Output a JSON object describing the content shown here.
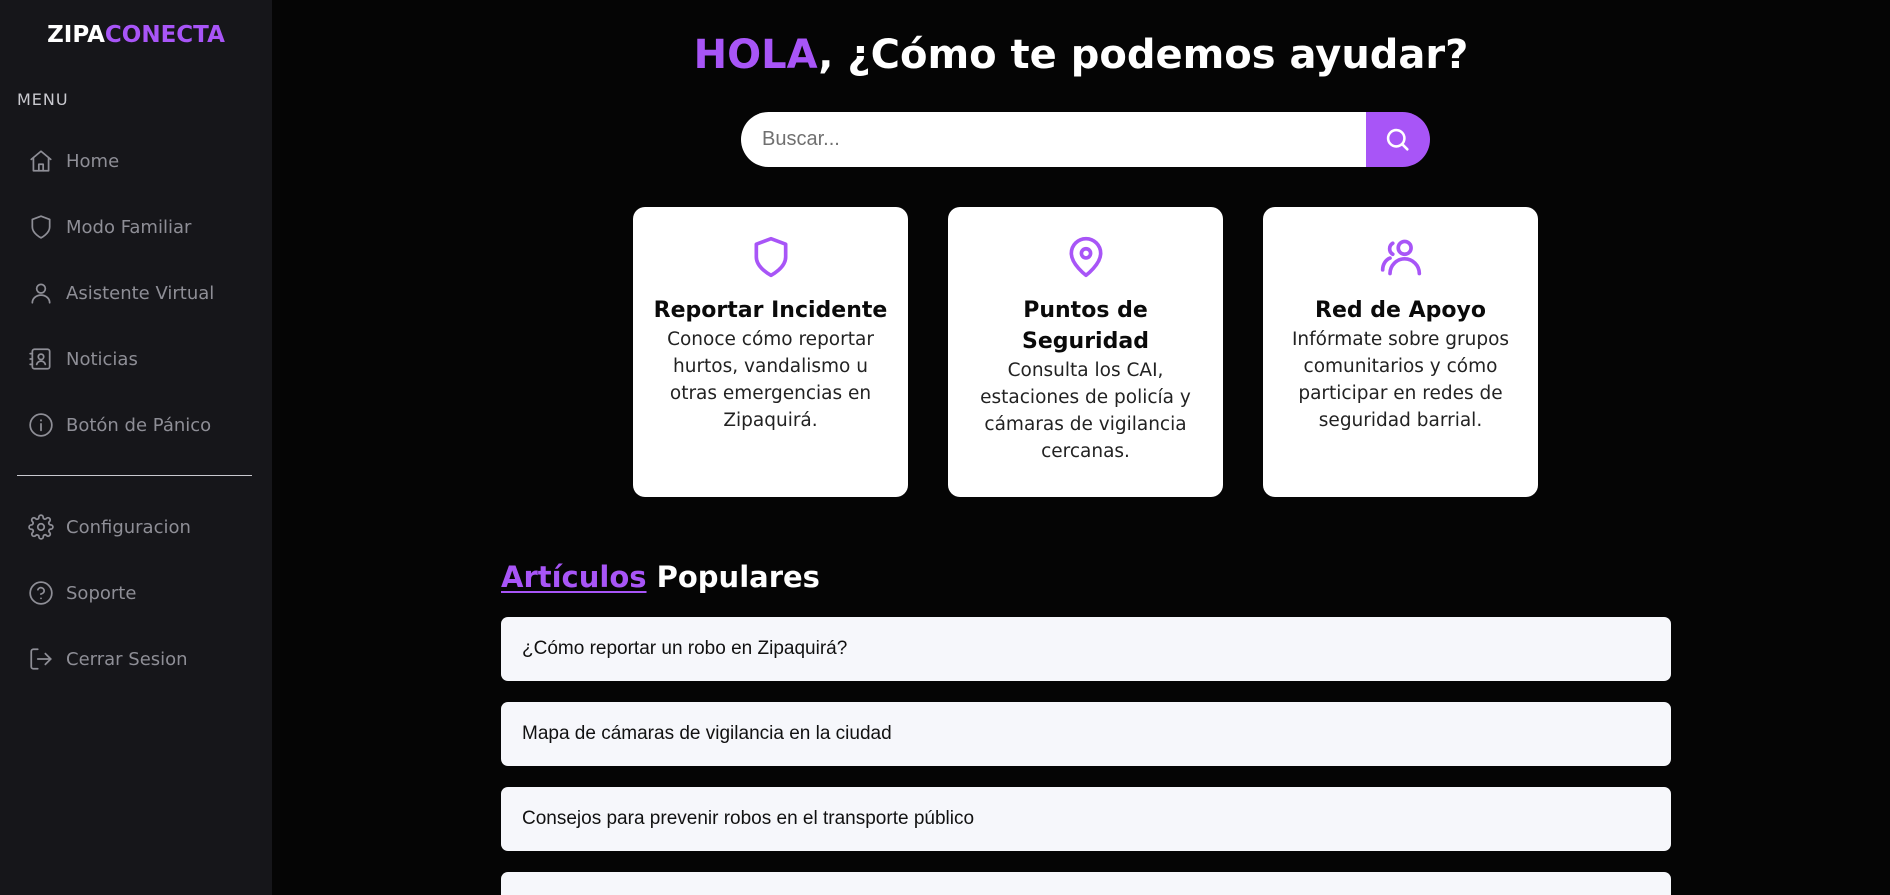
{
  "brand": {
    "part1": "ZIPA",
    "part2": "CONECTA"
  },
  "sidebar": {
    "menu_title": "MENU",
    "items": [
      {
        "label": "Home",
        "icon": "home-icon"
      },
      {
        "label": "Modo Familiar",
        "icon": "shield-icon"
      },
      {
        "label": "Asistente Virtual",
        "icon": "user-icon"
      },
      {
        "label": "Noticias",
        "icon": "contact-card-icon"
      },
      {
        "label": "Botón de Pánico",
        "icon": "info-circle-icon"
      }
    ],
    "bottom_items": [
      {
        "label": "Configuracion",
        "icon": "gear-icon"
      },
      {
        "label": "Soporte",
        "icon": "help-circle-icon"
      },
      {
        "label": "Cerrar Sesion",
        "icon": "logout-icon"
      }
    ]
  },
  "header": {
    "greeting": "HOLA",
    "question": ", ¿Cómo te podemos ayudar?"
  },
  "search": {
    "placeholder": "Buscar...",
    "value": "",
    "button_icon": "search-icon"
  },
  "cards": [
    {
      "icon": "shield-icon",
      "title": "Reportar Incidente",
      "text": "Conoce cómo reportar hurtos, vandalismo u otras emergencias en Zipaquirá."
    },
    {
      "icon": "map-pin-icon",
      "title": "Puntos de Seguridad",
      "text": "Consulta los CAI, estaciones de policía y cámaras de vigilancia cercanas."
    },
    {
      "icon": "users-icon",
      "title": "Red de Apoyo",
      "text": "Infórmate sobre grupos comunitarios y cómo participar en redes de seguridad barrial."
    }
  ],
  "articles_section": {
    "title_link": "Artículos",
    "title_rest": " Populares",
    "items": [
      "¿Cómo reportar un robo en Zipaquirá?",
      "Mapa de cámaras de vigilancia en la ciudad",
      "Consejos para prevenir robos en el transporte público",
      ""
    ]
  },
  "colors": {
    "accent": "#a855f7",
    "sidebar_bg": "#16161a",
    "page_bg": "#050505",
    "card_bg": "#ffffff",
    "article_bg": "#f6f7fb"
  }
}
